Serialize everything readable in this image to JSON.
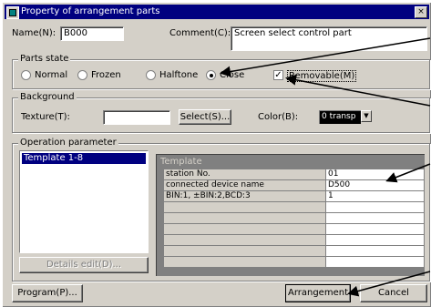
{
  "window": {
    "title": "Property of arrangement parts",
    "close_glyph": "×"
  },
  "name": {
    "label": "Name(N):",
    "value": "B000"
  },
  "comment": {
    "label": "Comment(C):",
    "value": "Screen select control part"
  },
  "parts_state": {
    "caption": "Parts state",
    "options": [
      {
        "label": "Normal",
        "selected": false
      },
      {
        "label": "Frozen",
        "selected": false
      },
      {
        "label": "Halftone",
        "selected": false
      },
      {
        "label": "Close",
        "selected": true
      }
    ],
    "removable": {
      "label": "Removable(M)",
      "checked": true,
      "check_glyph": "✓"
    }
  },
  "background": {
    "caption": "Background",
    "texture_label": "Texture(T):",
    "texture_value": "",
    "select_button": "Select(S)...",
    "color_label": "Color(B):",
    "color_value": "0 transp",
    "dropdown_glyph": "▼"
  },
  "operation": {
    "caption": "Operation parameter",
    "templates": [
      "Template 1-8"
    ],
    "details_button": "Details edit(D)...",
    "template_header": "Template",
    "rows": [
      {
        "name": "station No.",
        "value": "01"
      },
      {
        "name": "connected device name",
        "value": "D500"
      },
      {
        "name": "BIN:1, ±BIN:2,BCD:3",
        "value": "1"
      },
      {
        "name": "",
        "value": ""
      },
      {
        "name": "",
        "value": ""
      },
      {
        "name": "",
        "value": ""
      },
      {
        "name": "",
        "value": ""
      },
      {
        "name": "",
        "value": ""
      },
      {
        "name": "",
        "value": ""
      }
    ]
  },
  "footer": {
    "program_button": "Program(P)...",
    "arrangement_button": "Arrangement",
    "cancel_button": "Cancel"
  },
  "colors": {
    "titlebar": "#000080",
    "dialog": "#d4d0c8",
    "selection": "#000080"
  }
}
